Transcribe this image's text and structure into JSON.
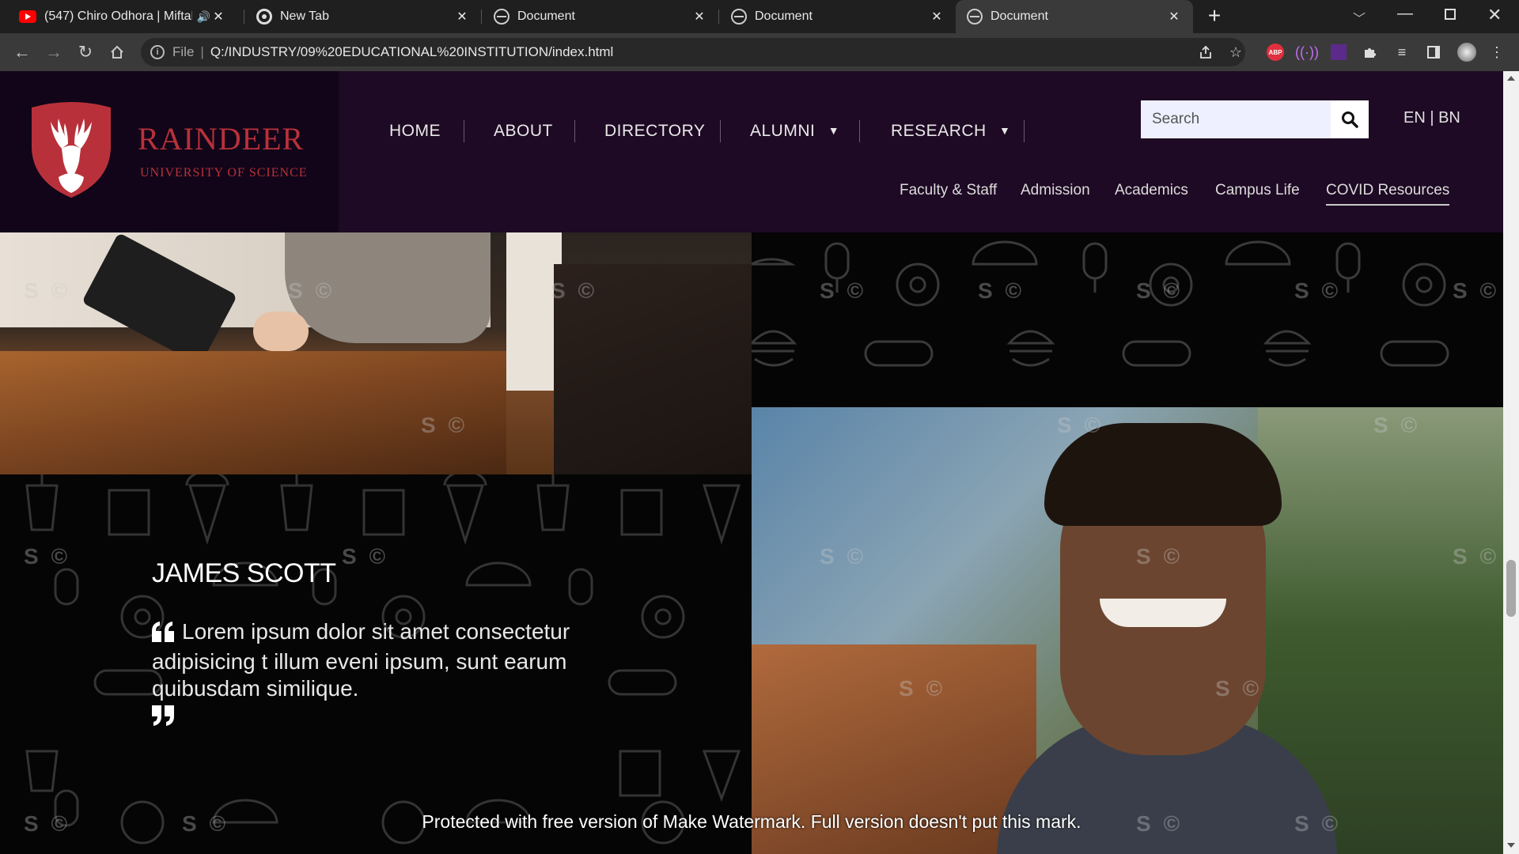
{
  "browser": {
    "tabs": [
      {
        "title": "(547) Chiro Odhora | Miftah",
        "favicon": "youtube-icon",
        "audio": true
      },
      {
        "title": "New Tab",
        "favicon": "chrome-icon"
      },
      {
        "title": "Document",
        "favicon": "globe-icon"
      },
      {
        "title": "Document",
        "favicon": "globe-icon"
      },
      {
        "title": "Document",
        "favicon": "globe-icon",
        "active": true
      }
    ],
    "address": {
      "scheme_label": "File",
      "url": "Q:/INDUSTRY/09%20EDUCATIONAL%20INSTITUTION/index.html"
    },
    "extension_labels": {
      "abp": "ABP"
    }
  },
  "site": {
    "brand": {
      "name": "RAINDEER",
      "tagline": "UNIVERSITY OF SCIENCE"
    },
    "nav": [
      {
        "label": "HOME"
      },
      {
        "label": "ABOUT"
      },
      {
        "label": "DIRECTORY"
      },
      {
        "label": "ALUMNI",
        "dropdown": true
      },
      {
        "label": "RESEARCH",
        "dropdown": true
      }
    ],
    "dropdown_glyph": "▼",
    "subnav": [
      "Faculty & Staff",
      "Admission",
      "Academics",
      "Campus Life",
      "COVID Resources"
    ],
    "subnav_active": "COVID Resources",
    "search": {
      "placeholder": "Search"
    },
    "language": "EN | BN"
  },
  "testimonial": {
    "name": "JAMES SCOTT",
    "quote": "Lorem ipsum dolor sit amet consectetur adipisicing t illum eveni ipsum, sunt earum quibusdam similique."
  },
  "watermark": {
    "notice": "Protected with free version of Make Watermark. Full version doesn't put this mark.",
    "mark": "S ©"
  },
  "colors": {
    "header_bg": "#1e0a24",
    "brand_red": "#b8313a",
    "accent_line": "#c9c9c9"
  }
}
